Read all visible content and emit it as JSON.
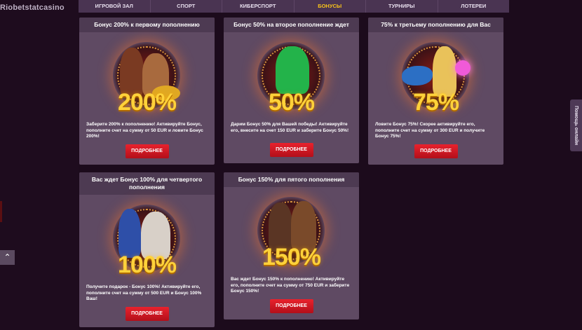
{
  "logo": {
    "text": "Riobetstatcasino"
  },
  "nav": {
    "items": [
      {
        "label": "ИГРОВОЙ ЗАЛ",
        "active": false
      },
      {
        "label": "СПОРТ",
        "active": false
      },
      {
        "label": "КИБЕРСПОРТ",
        "active": false
      },
      {
        "label": "БОНУСЫ",
        "active": true
      },
      {
        "label": "ТУРНИРЫ",
        "active": false
      },
      {
        "label": "ЛОТЕРЕИ",
        "active": false
      }
    ]
  },
  "help_tab": {
    "label": "Помощь онлайн"
  },
  "scroll_up": {
    "icon": "chevron-up-icon",
    "glyph": "⌃"
  },
  "colors": {
    "active_nav": "#f7c21a",
    "button_red": "#d8182a",
    "percent_gold": "#ffd23a"
  },
  "cards": [
    {
      "title": "Бонус 200% к первому пополнению",
      "percent": "200%",
      "text": "Заберите 200% к пополнению! Активируйте Бонус, пополните счет на сумму от 50 EUR и ловите Бонус 200%!",
      "button": "ПОДРОБНЕЕ"
    },
    {
      "title": "Бонус 50% на второе пополнение ждет",
      "percent": "50%",
      "text": "Дарим Бонус 50% для Вашей победы! Активируйте его, внесите на счет 150 EUR и заберите Бонус 50%!",
      "button": "ПОДРОБНЕЕ"
    },
    {
      "title": "75% к третьему пополнению для Вас",
      "percent": "75%",
      "text": "Ловите Бонус 75%! Скорее активируйте его, пополните счет на сумму от 300 EUR и получите Бонус 75%!",
      "button": "ПОДРОБНЕЕ"
    },
    {
      "title": "Вас ждет Бонус 100% для четвертого пополнения",
      "percent": "100%",
      "text": "Получите подарок - Бонус 100%! Активируйте его, пополните счет на сумму от 500 EUR и Бонус 100% Ваш!",
      "button": "ПОДРОБНЕЕ"
    },
    {
      "title": "Бонус 150% для пятого пополнения",
      "percent": "150%",
      "text": "Вас ждет Бонус 150% к пополнению! Активируйте его, пополните счет на сумму от 750 EUR и заберите Бонус 150%!",
      "button": "ПОДРОБНЕЕ"
    }
  ]
}
